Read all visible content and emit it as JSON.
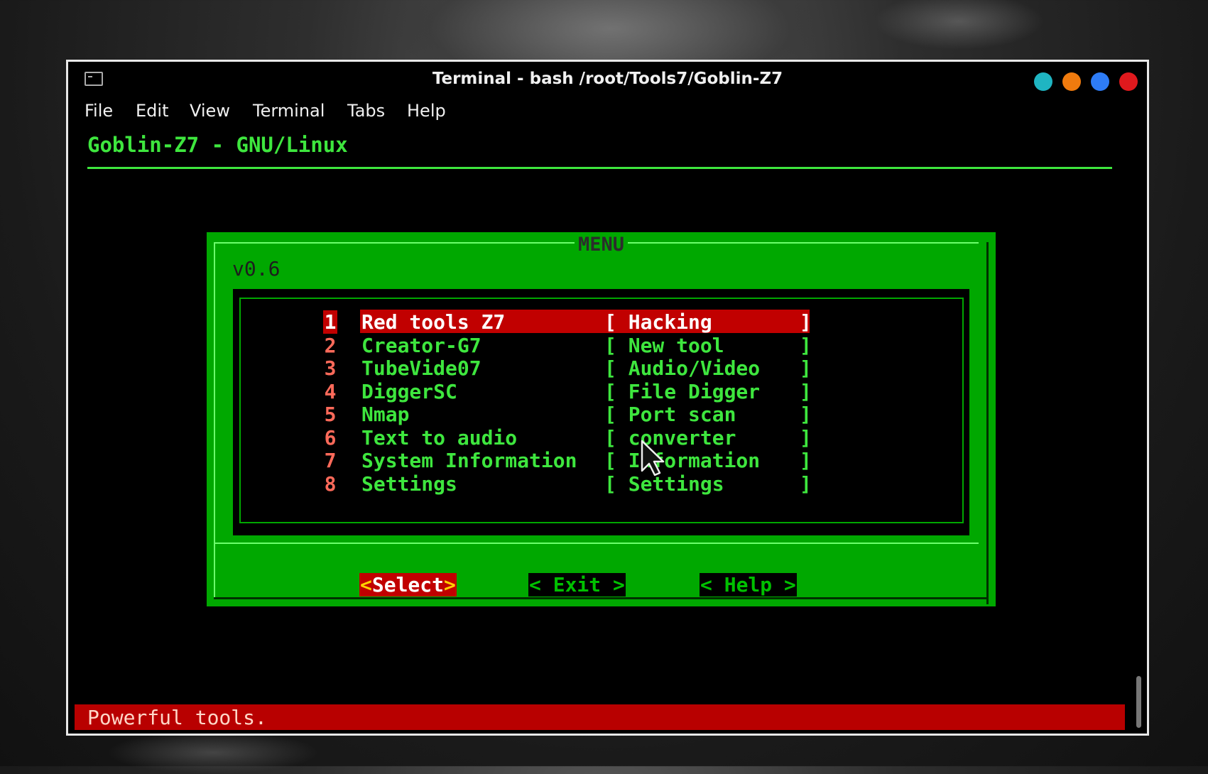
{
  "window": {
    "title": "Terminal - bash /root/Tools7/Goblin-Z7",
    "controls": [
      "#1fb5c2",
      "#f07b0e",
      "#2e7cf6",
      "#e0191d"
    ]
  },
  "menubar": [
    "File",
    "Edit",
    "View",
    "Terminal",
    "Tabs",
    "Help"
  ],
  "backtitle": "Goblin-Z7 - GNU/Linux",
  "dialog": {
    "title": "MENU",
    "subtitle": "v0.6",
    "items": [
      {
        "num": "1",
        "name": "Red tools Z7",
        "desc": "Hacking",
        "selected": true
      },
      {
        "num": "2",
        "name": "Creator-G7",
        "desc": "New tool"
      },
      {
        "num": "3",
        "name": "TubeVide07",
        "desc": "Audio/Video"
      },
      {
        "num": "4",
        "name": "DiggerSC",
        "desc": "File Digger"
      },
      {
        "num": "5",
        "name": "Nmap",
        "desc": "Port scan"
      },
      {
        "num": "6",
        "name": "Text to audio",
        "desc": "converter"
      },
      {
        "num": "7",
        "name": "System Information",
        "desc": "Information"
      },
      {
        "num": "8",
        "name": "Settings",
        "desc": "Settings"
      }
    ],
    "buttons": {
      "select": "Select",
      "exit": "< Exit >",
      "help": "< Help >"
    }
  },
  "status": "Powerful tools."
}
